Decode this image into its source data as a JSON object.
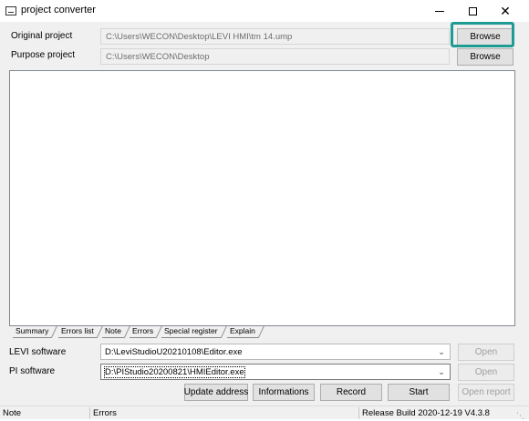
{
  "window": {
    "title": "project converter",
    "minimize_icon": "minimize-icon",
    "maximize_icon": "maximize-icon",
    "close_icon": "close-icon",
    "close_glyph": "✕"
  },
  "paths": {
    "original_label": "Original project",
    "original_value": "C:\\Users\\WECON\\Desktop\\LEVI HMI\\tm 14.ump",
    "purpose_label": "Purpose project",
    "purpose_value": "C:\\Users\\WECON\\Desktop",
    "browse_label": "Browse"
  },
  "tabs": [
    {
      "label": "Summary"
    },
    {
      "label": "Errors list"
    },
    {
      "label": "Note"
    },
    {
      "label": "Errors"
    },
    {
      "label": "Special register"
    },
    {
      "label": "Explain"
    }
  ],
  "software": {
    "levi_label": "LEVI software",
    "levi_value": "D:\\LeviStudioU20210108\\Editor.exe",
    "pi_label": "PI software",
    "pi_value": "D:\\PIStudio20200821\\HMIEditor.exe",
    "open_label": "Open"
  },
  "actions": {
    "update_address": "Update address",
    "informations": "Informations",
    "record": "Record",
    "start": "Start",
    "open_report": "Open report"
  },
  "status": {
    "note": "Note",
    "errors": "Errors",
    "release": "Release Build 2020-12-19 V4.3.8"
  },
  "colors": {
    "highlight": "#1e9b93",
    "window_bg": "#f0f0f0"
  }
}
